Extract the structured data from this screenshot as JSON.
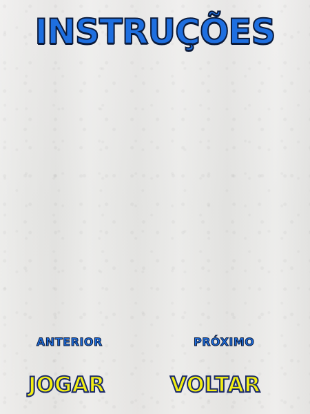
{
  "screen": {
    "title": "INSTRUÇÕES"
  },
  "navigation": {
    "previous_label": "ANTERIOR",
    "next_label": "PRÓXIMO"
  },
  "actions": {
    "play_label": "JOGAR",
    "back_label": "VOLTAR"
  },
  "colors": {
    "title": "#1e6fe0",
    "outline": "#0b1a3a",
    "action": "#f4ef12",
    "background": "#e9e9e7"
  }
}
